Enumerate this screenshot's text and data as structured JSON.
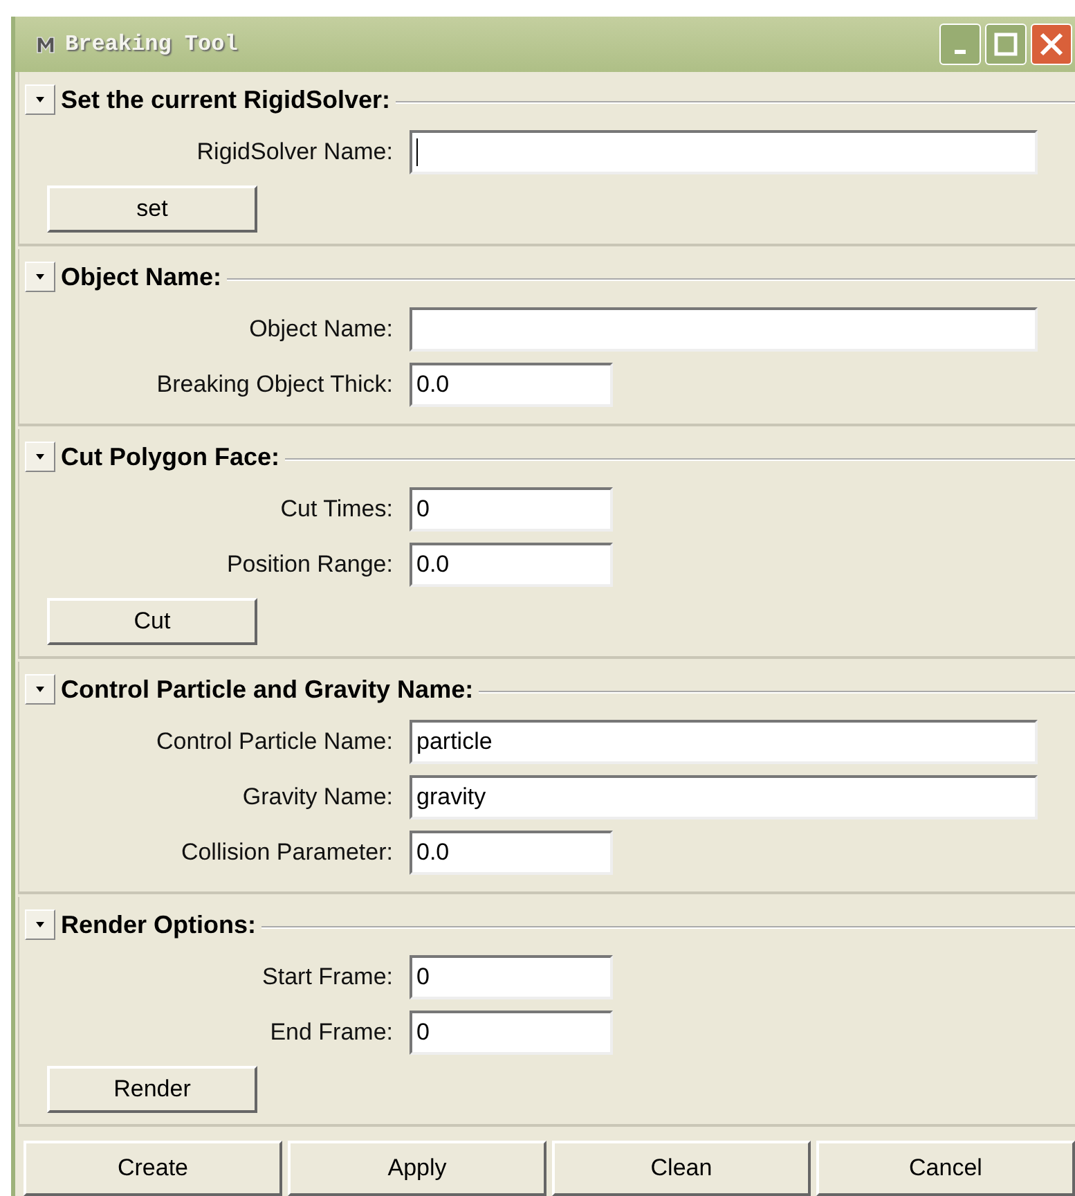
{
  "window": {
    "title": "Breaking Tool"
  },
  "sections": [
    {
      "title": "Set the current RigidSolver:",
      "expanded": true,
      "fields": [
        {
          "label": "RigidSolver Name:",
          "kind": "wide",
          "focused": true
        }
      ],
      "button": "set"
    },
    {
      "title": "Object Name:",
      "expanded": true,
      "fields": [
        {
          "label": "Object Name:",
          "kind": "wide",
          "focused": false
        },
        {
          "label": "Breaking Object Thick:",
          "value": "0.0",
          "kind": "short",
          "focused": false
        }
      ]
    },
    {
      "title": "Cut Polygon Face:",
      "expanded": true,
      "fields": [
        {
          "label": "Cut Times:",
          "value": "0",
          "kind": "short",
          "focused": false
        },
        {
          "label": "Position Range:",
          "value": "0.0",
          "kind": "short",
          "focused": false
        }
      ],
      "button": "Cut"
    },
    {
      "title": "Control Particle and Gravity Name:",
      "expanded": true,
      "fields": [
        {
          "label": "Control Particle Name:",
          "value": "particle",
          "kind": "wide",
          "focused": false
        },
        {
          "label": "Gravity Name:",
          "value": "gravity",
          "kind": "wide",
          "focused": false
        },
        {
          "label": "Collision Parameter:",
          "value": "0.0",
          "kind": "short",
          "focused": false
        }
      ]
    },
    {
      "title": "Render Options:",
      "expanded": true,
      "fields": [
        {
          "label": "Start Frame:",
          "value": "0",
          "kind": "short",
          "focused": false
        },
        {
          "label": "End Frame:",
          "value": "0",
          "kind": "short",
          "focused": false
        }
      ],
      "button": "Render"
    }
  ],
  "buttons": [
    "Create",
    "Apply",
    "Clean",
    "Cancel"
  ]
}
